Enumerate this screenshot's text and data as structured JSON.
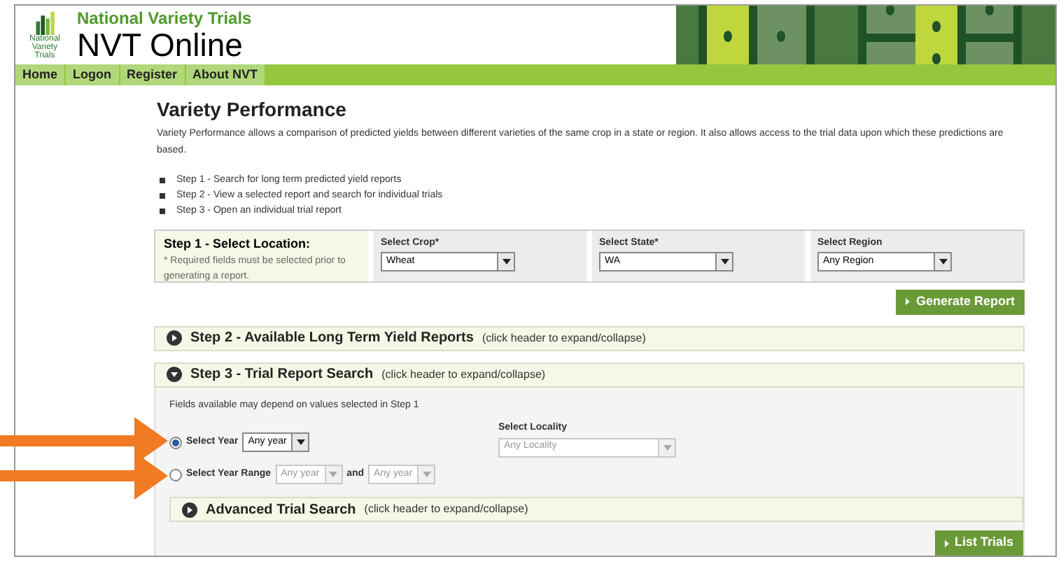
{
  "header": {
    "logo_text": [
      "National",
      "Variety",
      "Trials"
    ],
    "subtitle": "National Variety Trials",
    "title": "NVT Online"
  },
  "nav": [
    {
      "label": "Home"
    },
    {
      "label": "Logon"
    },
    {
      "label": "Register"
    },
    {
      "label": "About NVT"
    }
  ],
  "page": {
    "title": "Variety Performance",
    "intro": "Variety Performance allows a comparison of predicted yields between different varieties of the same crop in a state or region. It also allows access to the trial data upon which these predictions are based.",
    "steps": [
      "Step 1 - Search for long term predicted yield reports",
      "Step 2 - View a selected report and search for individual trials",
      "Step 3 - Open an individual trial report"
    ]
  },
  "step1": {
    "title": "Step 1 - Select Location:",
    "note": "* Required fields must be selected prior to generating a report.",
    "selects": [
      {
        "label": "Select Crop*",
        "value": "Wheat"
      },
      {
        "label": "Select State*",
        "value": "WA"
      },
      {
        "label": "Select Region",
        "value": "Any Region"
      }
    ],
    "button": "Generate Report"
  },
  "sections": [
    {
      "title": "Step 2 - Available Long Term Yield Reports",
      "hint": "(click header to expand/collapse)",
      "expanded": false
    },
    {
      "title": "Step 3 - Trial Report Search",
      "hint": "(click header to expand/collapse)",
      "expanded": true
    }
  ],
  "step3": {
    "note": "Fields available may depend on values selected in Step 1",
    "year": {
      "label": "Select Year",
      "selected": true,
      "value": "Any year",
      "disabled": false
    },
    "range": {
      "label": "Select Year Range",
      "selected": false,
      "from": "Any year",
      "joiner": "and",
      "to": "Any year",
      "disabled": true
    },
    "locality": {
      "label": "Select Locality",
      "value": "Any Locality",
      "disabled": true
    },
    "advanced": {
      "title": "Advanced Trial Search",
      "hint": "(click header to expand/collapse)",
      "expanded": false
    },
    "button": "List Trials"
  }
}
